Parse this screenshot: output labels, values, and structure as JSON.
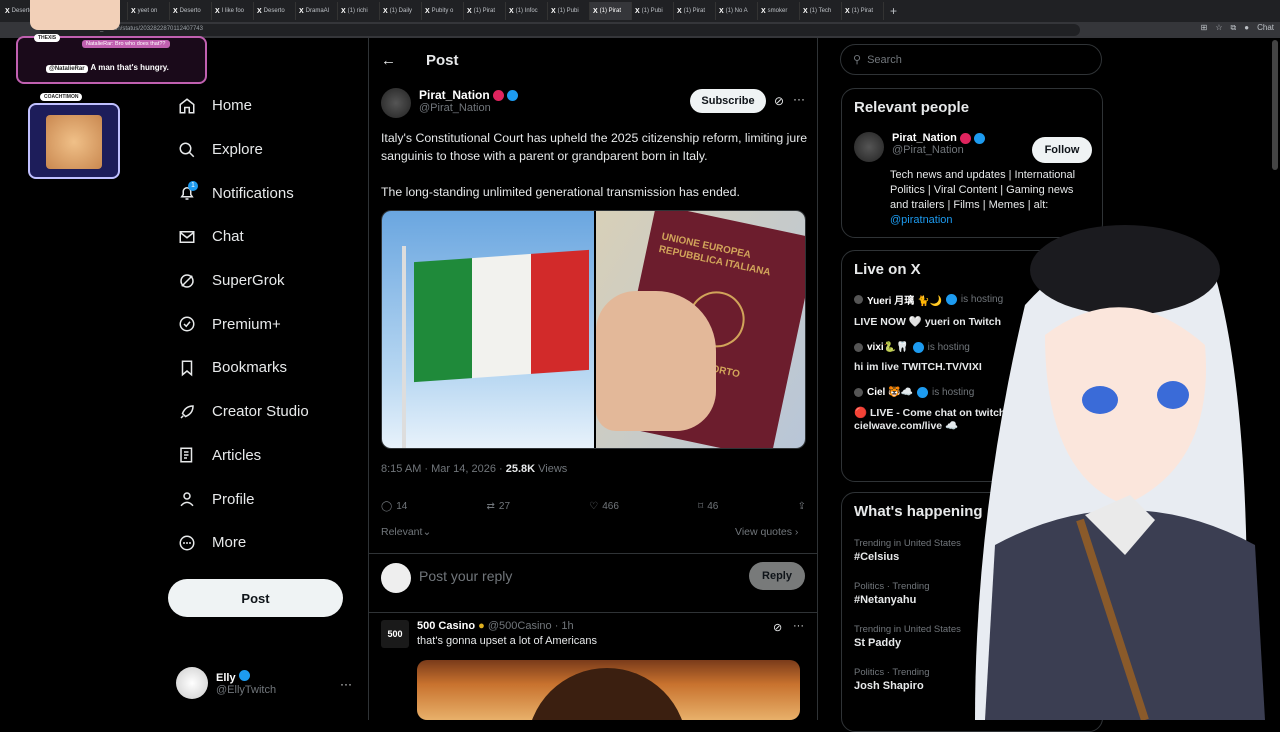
{
  "browser": {
    "tabs": [
      "Deserto",
      "velzau o",
      "yeet on",
      "yeet on",
      "Deserto",
      "I like foo",
      "Deserto",
      "DramaAl",
      "(1) richi",
      "(1) Daily",
      "Pubity o",
      "(1) Pirat",
      "(1) Infoc",
      "(1) Pubi",
      "(1) Pirat",
      "(1) Pubi",
      "(1) Pirat",
      "(1) No A",
      "smoker",
      "(1) Tech",
      "(1) Pirat"
    ],
    "url": "x.com/Pirat_Nation/status/2032822870112407743",
    "right_label": "Chat"
  },
  "nav": {
    "items": [
      {
        "label": "Home",
        "icon": "home-icon"
      },
      {
        "label": "Explore",
        "icon": "search-icon"
      },
      {
        "label": "Notifications",
        "icon": "bell-icon",
        "badge": "1"
      },
      {
        "label": "Chat",
        "icon": "mail-icon"
      },
      {
        "label": "SuperGrok",
        "icon": "grok-icon"
      },
      {
        "label": "Premium+",
        "icon": "premium-icon"
      },
      {
        "label": "Bookmarks",
        "icon": "bookmark-icon"
      },
      {
        "label": "Creator Studio",
        "icon": "rocket-icon"
      },
      {
        "label": "Articles",
        "icon": "articles-icon"
      },
      {
        "label": "Profile",
        "icon": "person-icon"
      },
      {
        "label": "More",
        "icon": "more-icon"
      }
    ],
    "post_label": "Post",
    "account": {
      "name": "Elly",
      "handle": "@EllyTwitch",
      "more": "···"
    }
  },
  "post": {
    "back_title": "Post",
    "author": {
      "name": "Pirat_Nation",
      "handle": "@Pirat_Nation"
    },
    "subscribe_label": "Subscribe",
    "text_1": "Italy's Constitutional Court has upheld the 2025 citizenship reform, limiting jure sanguinis to those with a parent or grandparent born in Italy.",
    "text_2": "The long-standing unlimited generational transmission has ended.",
    "passport_text": "UNIONE EUROPEA REPUBBLICA ITALIANA",
    "passport_bottom": "PASSAPORTO",
    "time": "8:15 AM · Mar 14, 2026 · ",
    "views_count": "25.8K",
    "views_label": " Views",
    "stats": {
      "replies": "14",
      "reposts": "27",
      "likes": "466",
      "bookmarks": "46"
    },
    "sort_label": "Relevant⌄",
    "view_quotes": "View quotes ›",
    "reply_placeholder": "Post your reply",
    "reply_button": "Reply"
  },
  "reply": {
    "avatar_text": "500",
    "name": "500 Casino",
    "handle": "@500Casino · 1h",
    "text": "that's gonna upset a lot of Americans"
  },
  "sidebar": {
    "search_placeholder": "Search",
    "relevant_title": "Relevant people",
    "person": {
      "name": "Pirat_Nation",
      "handle": "@Pirat_Nation",
      "follow": "Follow",
      "bio": "Tech news and updates | International Politics | Viral Content | Gaming news and trailers | Films | Memes | alt:",
      "bio_link": "@piratnation"
    },
    "live_title": "Live on X",
    "live": [
      {
        "host": "Yueri 月璃 🐈🌙",
        "status": " is hosting",
        "title": "LIVE NOW 🤍 yueri on Twitch"
      },
      {
        "host": "vixi🐍🦷",
        "status": " is hosting",
        "title": "hi im live TWITCH.TV/VIXI"
      },
      {
        "host": "Ciel 🐯☁️",
        "status": " is hosting",
        "title": "🔴 LIVE - Come chat on twitch 🐯 cielwave.com/live ☁️"
      }
    ],
    "trends_title": "What's happening",
    "trends": [
      {
        "context": "Trending in United States",
        "name": "#Celsius"
      },
      {
        "context": "Politics · Trending",
        "name": "#Netanyahu"
      },
      {
        "context": "Trending in United States",
        "name": "St Paddy"
      },
      {
        "context": "Politics · Trending",
        "name": "Josh Shapiro"
      }
    ]
  },
  "overlay": {
    "chat_label": "THEXIS",
    "chat_line1": "NatalieRar: Bro who does that??",
    "chat_user": "@NatalieRar",
    "chat_line2": "A man that's hungry.",
    "cam_label": "COACHTIMON"
  }
}
